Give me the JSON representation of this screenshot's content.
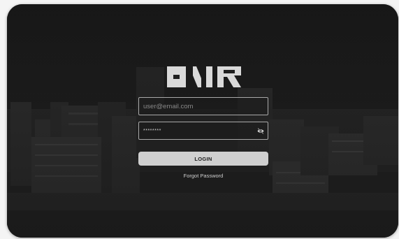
{
  "brand": {
    "logo_text": "ONR",
    "logo_color": "#d9d9d9"
  },
  "login_form": {
    "email": {
      "placeholder": "user@email.com",
      "value": ""
    },
    "password": {
      "value": "********",
      "visibility_icon": "eye-slash-icon"
    },
    "login_label": "LOGIN",
    "forgot_label": "Forgot Password"
  },
  "colors": {
    "card_background": "#1f1f1f",
    "page_background": "#f4f4f4",
    "button_background": "#cfcfcf",
    "field_border": "#a9a9a9"
  }
}
